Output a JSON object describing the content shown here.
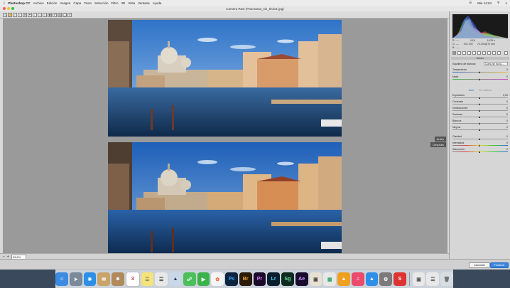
{
  "menubar": {
    "app": "Photoshop CC",
    "items": [
      "Archivo",
      "Edición",
      "Imagen",
      "Capa",
      "Texto",
      "Selección",
      "Filtro",
      "3D",
      "Vista",
      "Ventana",
      "Ayuda"
    ],
    "time": "Mie 14:04"
  },
  "window": {
    "title": "Camera Raw (Panorama_sin_título1.jpg)"
  },
  "preview": {
    "before_label": "Antes",
    "after_label": "Después",
    "zoom": "39,6%"
  },
  "histogram": {
    "r_label": "R:",
    "r_value": "----",
    "g_label": "G:",
    "g_value": "----",
    "b_label": "B:",
    "b_value": "----",
    "f_value": "f/5,6",
    "shutter": "1/125 s",
    "iso": "ISO 200",
    "lens": "70-200@70 mm"
  },
  "basic": {
    "section": "Básico",
    "white_balance_label": "Equilibrio de blancos:",
    "white_balance_value": "Como se ha to...",
    "auto": "Auto",
    "default": "Por defecto",
    "sliders": [
      {
        "label": "Temperatura",
        "value": "0"
      },
      {
        "label": "Matiz",
        "value": "0"
      },
      {
        "label": "Exposición",
        "value": "0,00"
      },
      {
        "label": "Contraste",
        "value": "0"
      },
      {
        "label": "Iluminaciones",
        "value": "0"
      },
      {
        "label": "Sombras",
        "value": "0"
      },
      {
        "label": "Blancos",
        "value": "0"
      },
      {
        "label": "Negros",
        "value": "0"
      },
      {
        "label": "Claridad",
        "value": "0"
      },
      {
        "label": "Intensidad",
        "value": "0"
      },
      {
        "label": "Saturación",
        "value": "0"
      }
    ]
  },
  "footer": {
    "cancel": "Cancelar",
    "finish": "Finalizar"
  },
  "dock": {
    "labels": [
      "Ps",
      "Br",
      "Pr",
      "Lr",
      "Sg",
      "Ae",
      "S"
    ],
    "calendar_day": "3"
  }
}
